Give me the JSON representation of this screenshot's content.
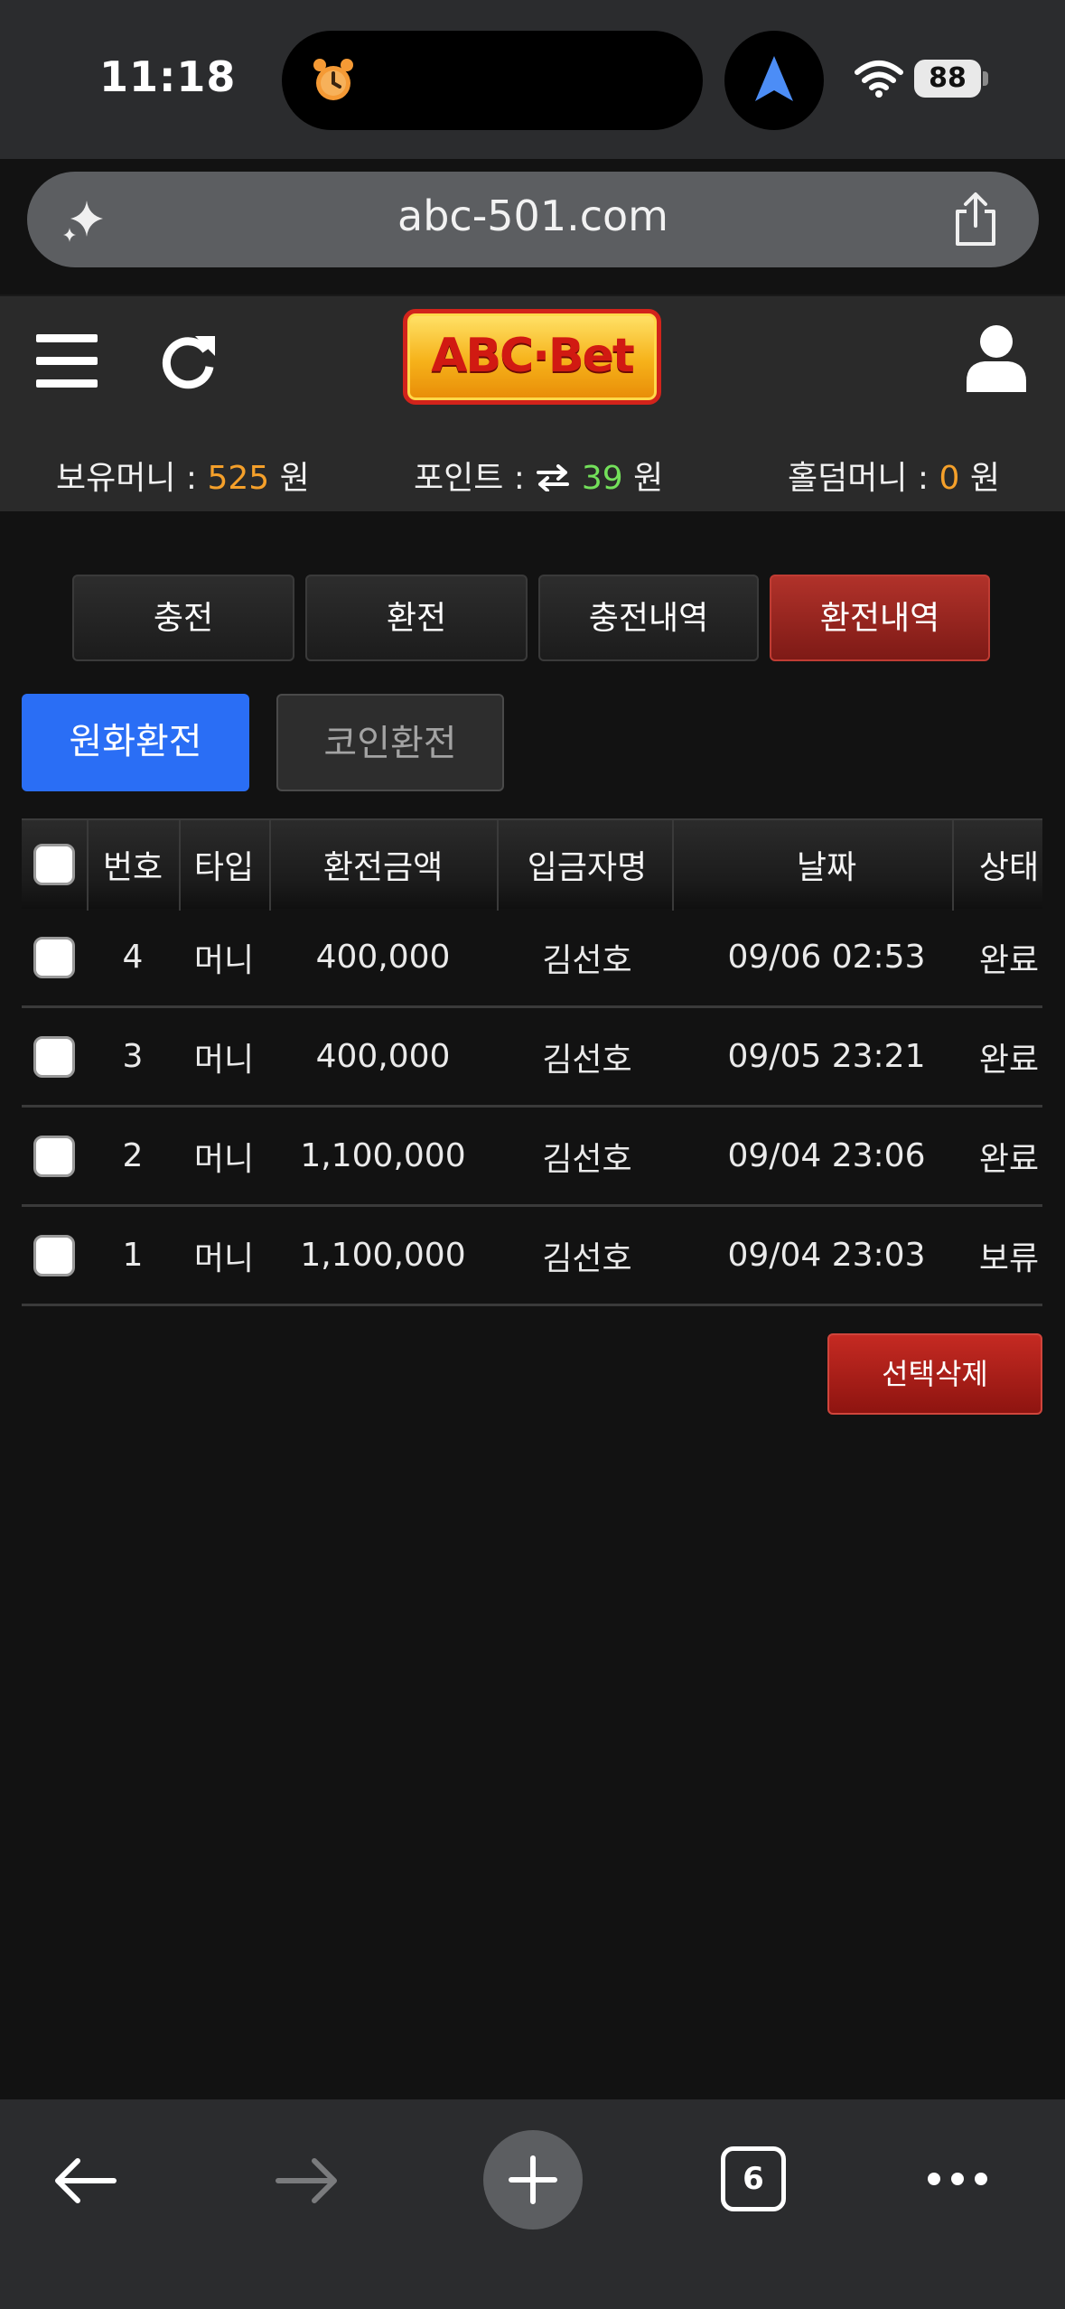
{
  "status_bar": {
    "time": "11:18",
    "battery": "88"
  },
  "browser": {
    "url": "abc-501.com",
    "tab_count": "6"
  },
  "header": {
    "logo": "ABC·Bet",
    "balances": {
      "money_label": "보유머니 : ",
      "money_value": "525",
      "money_unit": " 원",
      "point_label": "포인트 : ",
      "point_value": "39",
      "point_unit": " 원",
      "hold_label": "홀덤머니 : ",
      "hold_value": "0",
      "hold_unit": " 원"
    }
  },
  "tabs": [
    "충전",
    "환전",
    "충전내역",
    "환전내역"
  ],
  "active_tab": "환전내역",
  "subtabs": {
    "won": "원화환전",
    "coin": "코인환전"
  },
  "table": {
    "columns": [
      "번호",
      "타입",
      "환전금액",
      "입금자명",
      "날짜",
      "상태"
    ],
    "rows": [
      {
        "num": "4",
        "type": "머니",
        "amount": "400,000",
        "name": "김선호",
        "date": "09/06 02:53",
        "status": "완료"
      },
      {
        "num": "3",
        "type": "머니",
        "amount": "400,000",
        "name": "김선호",
        "date": "09/05 23:21",
        "status": "완료"
      },
      {
        "num": "2",
        "type": "머니",
        "amount": "1,100,000",
        "name": "김선호",
        "date": "09/04 23:06",
        "status": "완료"
      },
      {
        "num": "1",
        "type": "머니",
        "amount": "1,100,000",
        "name": "김선호",
        "date": "09/04 23:03",
        "status": "보류"
      }
    ]
  },
  "actions": {
    "delete_selected": "선택삭제"
  },
  "colors": {
    "accent_red": "#a8271f",
    "accent_blue": "#2a6ef5",
    "money_orange": "#f5a02a",
    "point_green": "#73e05a"
  }
}
